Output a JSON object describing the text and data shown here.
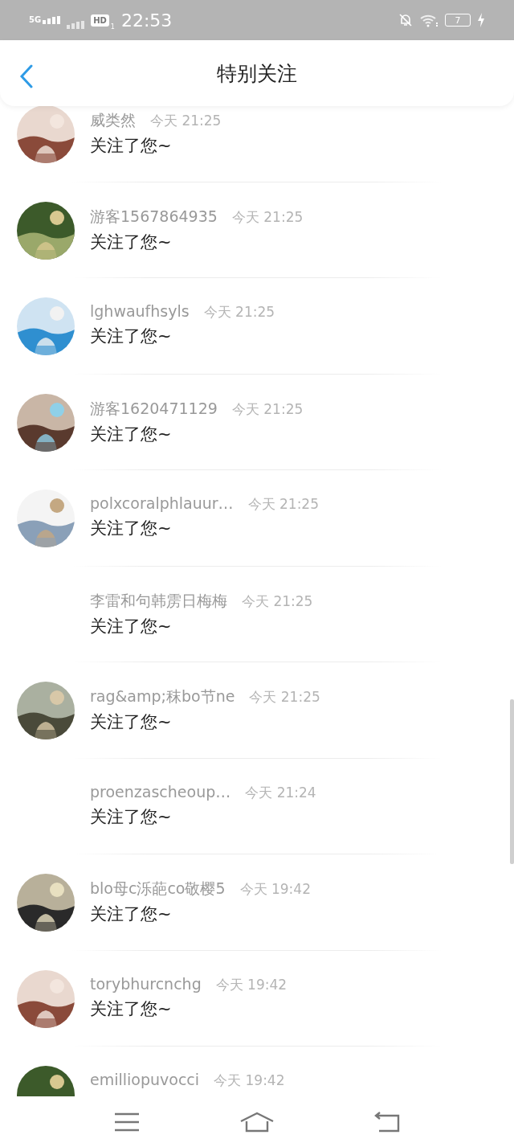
{
  "status_bar": {
    "network": "5G",
    "hd": "HD",
    "sim": "1",
    "time": "22:53",
    "battery": "7"
  },
  "header": {
    "title": "特别关注"
  },
  "items": [
    {
      "name": "威类然",
      "time": "今天 21:25",
      "message": "关注了您~",
      "has_avatar": true
    },
    {
      "name": "游客1567864935",
      "time": "今天 21:25",
      "message": "关注了您~",
      "has_avatar": true
    },
    {
      "name": "lghwaufhsyls",
      "time": "今天 21:25",
      "message": "关注了您~",
      "has_avatar": true
    },
    {
      "name": "游客1620471129",
      "time": "今天 21:25",
      "message": "关注了您~",
      "has_avatar": true
    },
    {
      "name": "polxcoralphlauur…",
      "time": "今天 21:25",
      "message": "关注了您~",
      "has_avatar": true
    },
    {
      "name": "李雷和句韩雳日梅梅",
      "time": "今天 21:25",
      "message": "关注了您~",
      "has_avatar": false
    },
    {
      "name": "rag&amp;秣bo节ne",
      "time": "今天 21:25",
      "message": "关注了您~",
      "has_avatar": true
    },
    {
      "name": "proenzascheoup…",
      "time": "今天 21:24",
      "message": "关注了您~",
      "has_avatar": false
    },
    {
      "name": "blo母c泺葩co敬樱5",
      "time": "今天 19:42",
      "message": "关注了您~",
      "has_avatar": true
    },
    {
      "name": "torybhurcnchg",
      "time": "今天 19:42",
      "message": "关注了您~",
      "has_avatar": true
    },
    {
      "name": "emilliopuvocci",
      "time": "今天 19:42",
      "has_avatar": true
    }
  ]
}
